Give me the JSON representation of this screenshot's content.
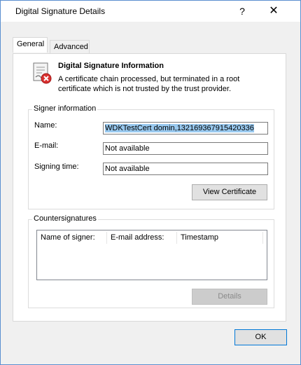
{
  "window": {
    "title": "Digital Signature Details",
    "help_glyph": "?",
    "close_glyph": "✕"
  },
  "tabs": [
    {
      "label": "General",
      "active": true
    },
    {
      "label": "Advanced",
      "active": false
    }
  ],
  "info": {
    "icon": "certificate-error-icon",
    "title": "Digital Signature Information",
    "message": "A certificate chain processed, but terminated in a root certificate which is not trusted by the trust provider."
  },
  "signer": {
    "group_label": "Signer information",
    "name_label": "Name:",
    "name_value": "WDKTestCert domin,132169367915420336",
    "email_label": "E-mail:",
    "email_value": "Not available",
    "time_label": "Signing time:",
    "time_value": "Not available",
    "view_cert_label": "View Certificate"
  },
  "counter": {
    "group_label": "Countersignatures",
    "columns": [
      "Name of signer:",
      "E-mail address:",
      "Timestamp"
    ],
    "details_label": "Details"
  },
  "footer": {
    "ok_label": "OK"
  },
  "colors": {
    "selection": "#99c9ef",
    "desktop": "#2a6fb8",
    "focus_border": "#0078d7"
  }
}
